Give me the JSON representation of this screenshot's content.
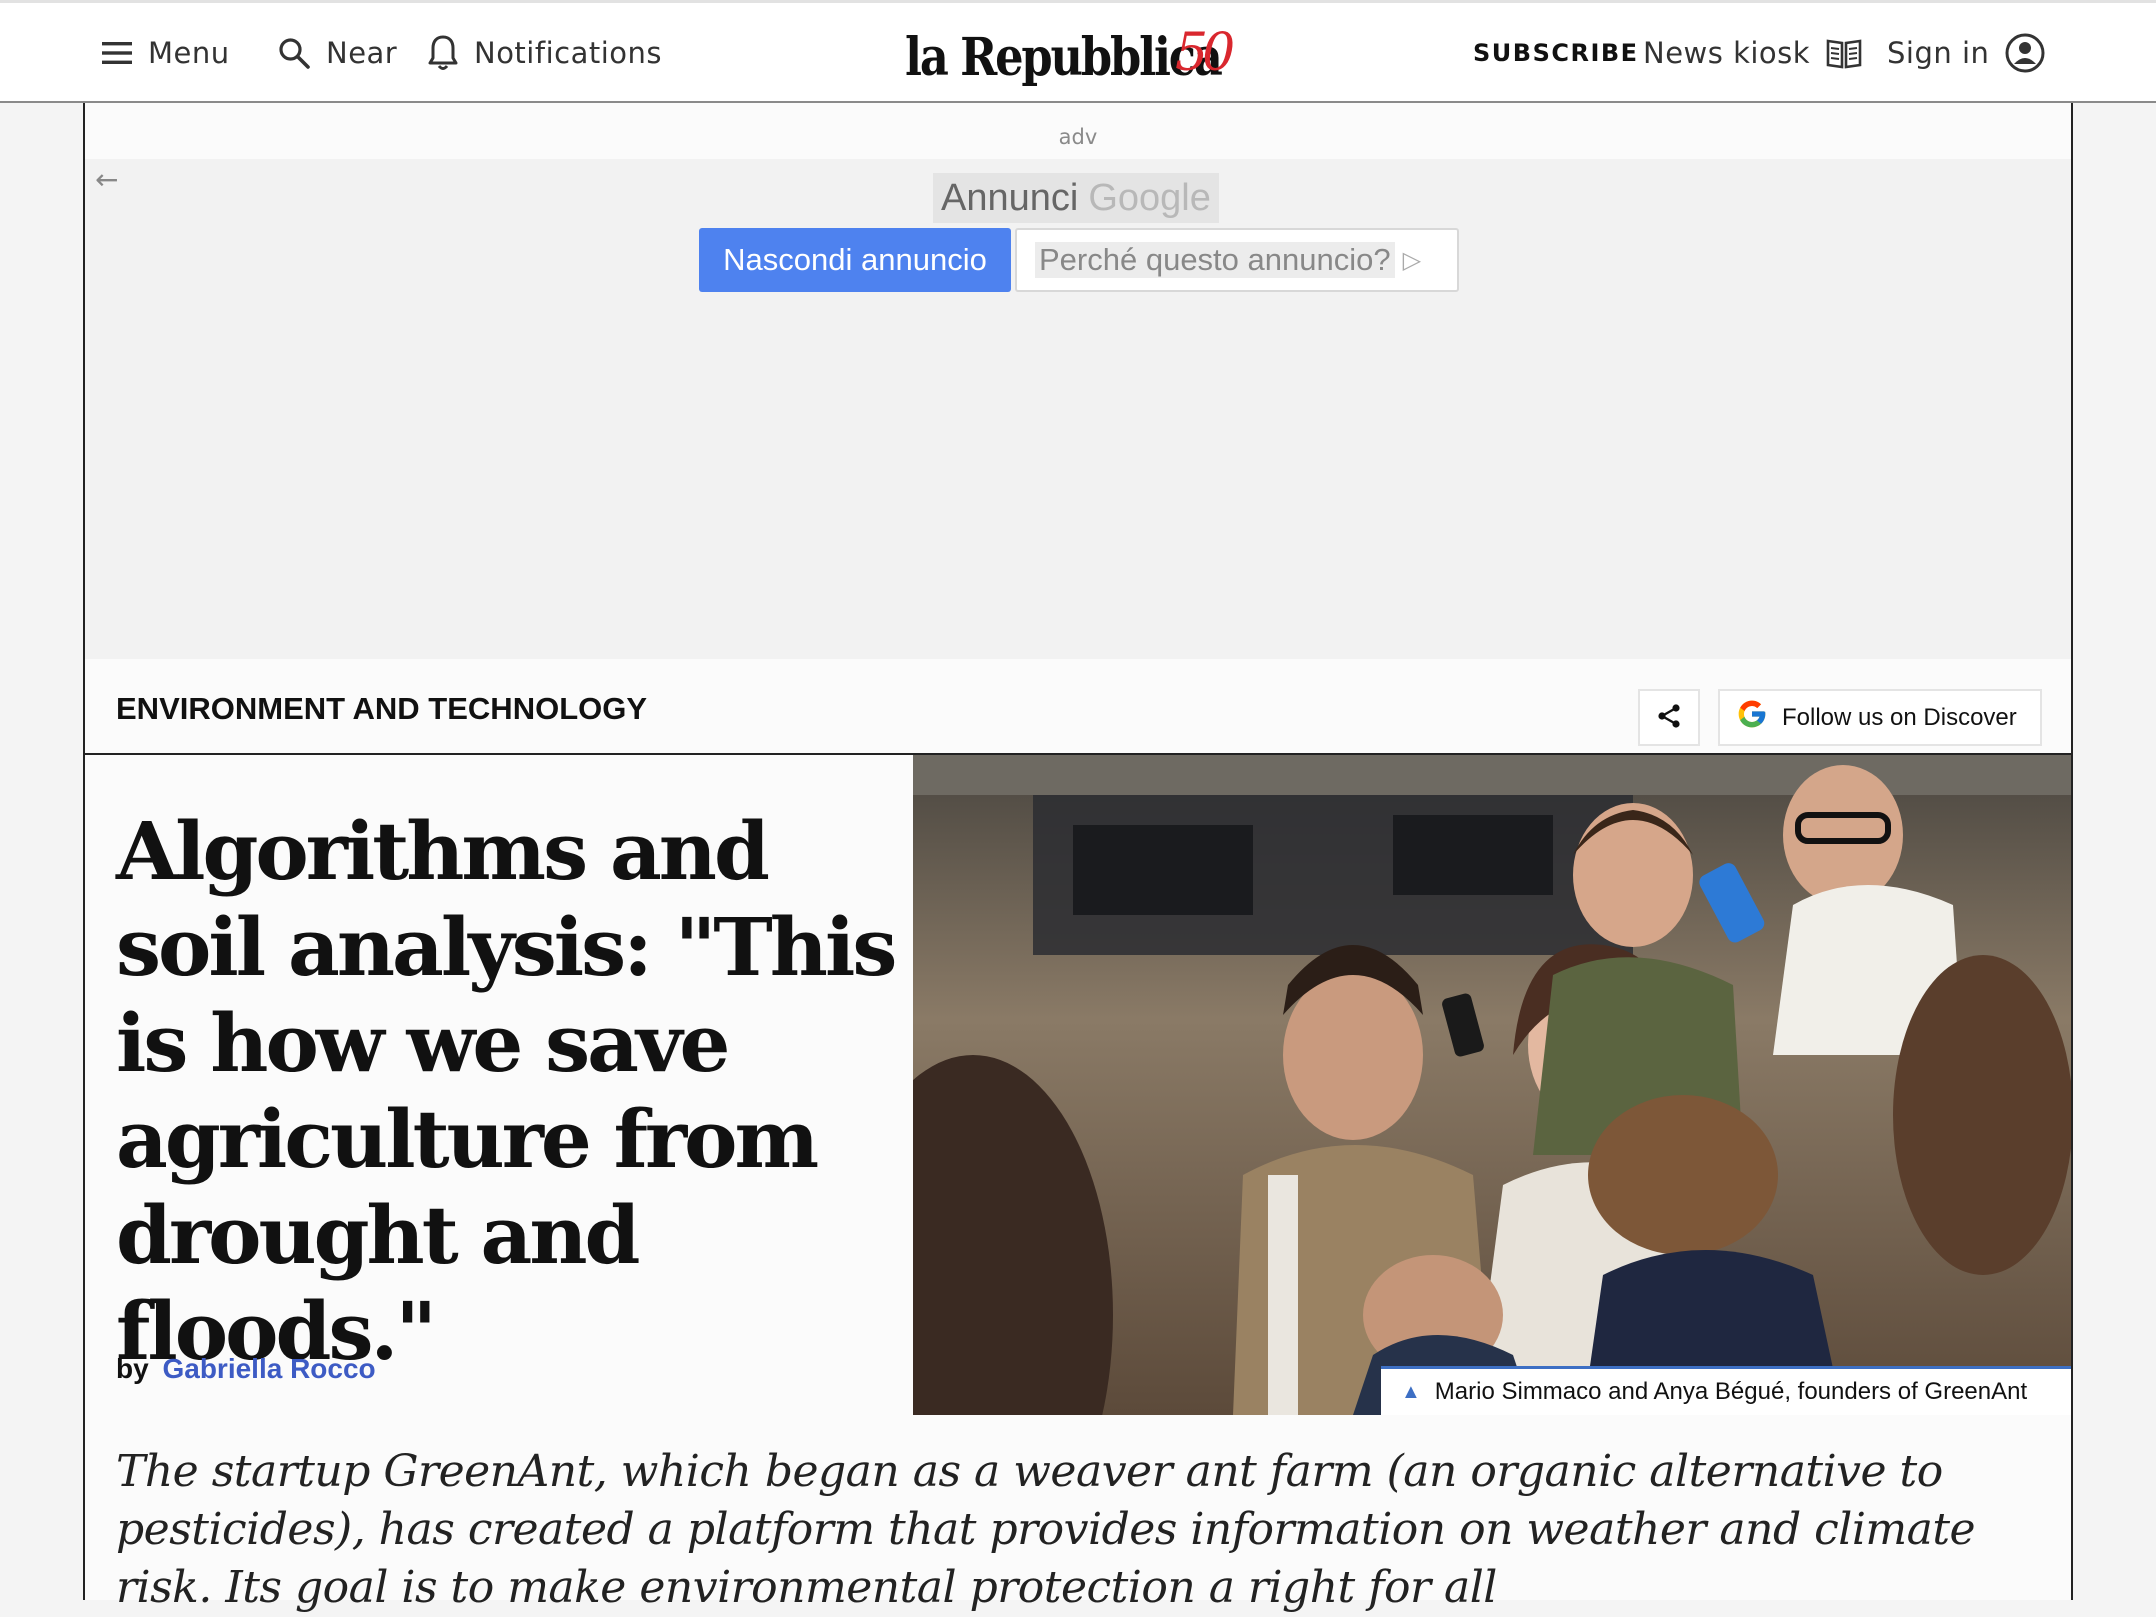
{
  "header": {
    "menu_label": "Menu",
    "near_label": "Near",
    "notifications_label": "Notifications",
    "logo_text": "la Repubblica",
    "logo_anniversary": "50",
    "subscribe_label": "SUBSCRIBE",
    "news_kiosk_label": "News kiosk",
    "sign_in_label": "Sign in"
  },
  "ad": {
    "adv_label": "adv",
    "back_arrow": "←",
    "brand_annunci": "Annunci",
    "brand_google": "Google",
    "hide_label": "Nascondi annuncio",
    "why_label": "Perché questo annuncio?",
    "why_icon": "▷"
  },
  "section": {
    "title": "ENVIRONMENT AND TECHNOLOGY",
    "follow_label": "Follow us on Discover",
    "share_icon": "share-icon",
    "google_icon": "google-g-icon"
  },
  "article": {
    "headline": "Algorithms and soil analysis: \"This is how we save agriculture from drought and floods.\"",
    "byline_prefix": "by",
    "author": "Gabriella Rocco",
    "photo_caption": "Mario Simmaco and Anya Bégué, founders of GreenAnt",
    "caption_icon": "▲",
    "lede": "The startup GreenAnt, which began as a weaver ant farm (an organic alternative to pesticides), has created a platform that provides information on weather and climate risk. Its goal is to make environmental protection a right for all"
  },
  "colors": {
    "accent_blue": "#3d5bc4",
    "ad_button_blue": "#4e82ef",
    "logo_red": "#d9272e"
  }
}
